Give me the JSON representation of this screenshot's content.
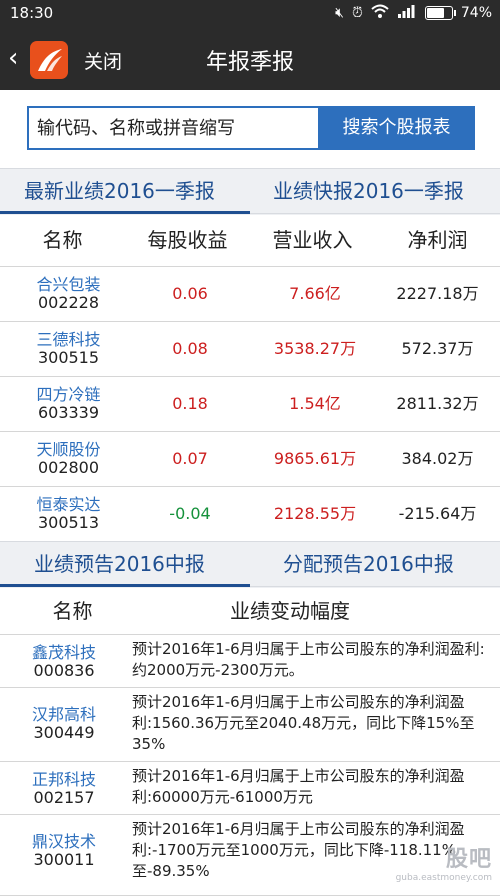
{
  "status": {
    "time": "18:30",
    "battery": "74%",
    "icons": [
      "mute-icon",
      "alarm-icon",
      "wifi-icon",
      "signal-icon",
      "battery-icon"
    ]
  },
  "nav": {
    "back_icon": "chevron-left-icon",
    "close_label": "关闭",
    "title": "年报季报"
  },
  "search": {
    "placeholder": "输代码、名称或拼音缩写",
    "value": "",
    "button_label": "搜索个股报表"
  },
  "tabs1": [
    {
      "label": "最新业绩2016一季报",
      "active": true
    },
    {
      "label": "业绩快报2016一季报",
      "active": false
    }
  ],
  "table1": {
    "headers": [
      "名称",
      "每股收益",
      "营业收入",
      "净利润"
    ],
    "rows": [
      {
        "name": "合兴包装",
        "code": "002228",
        "eps": "0.06",
        "revenue": "7.66亿",
        "profit": "2227.18万",
        "eps_color": "red"
      },
      {
        "name": "三德科技",
        "code": "300515",
        "eps": "0.08",
        "revenue": "3538.27万",
        "profit": "572.37万",
        "eps_color": "red"
      },
      {
        "name": "四方冷链",
        "code": "603339",
        "eps": "0.18",
        "revenue": "1.54亿",
        "profit": "2811.32万",
        "eps_color": "red"
      },
      {
        "name": "天顺股份",
        "code": "002800",
        "eps": "0.07",
        "revenue": "9865.61万",
        "profit": "384.02万",
        "eps_color": "red"
      },
      {
        "name": "恒泰实达",
        "code": "300513",
        "eps": "-0.04",
        "revenue": "2128.55万",
        "profit": "-215.64万",
        "eps_color": "green"
      }
    ]
  },
  "tabs2": [
    {
      "label": "业绩预告2016中报",
      "active": true
    },
    {
      "label": "分配预告2016中报",
      "active": false
    }
  ],
  "table2": {
    "headers": [
      "名称",
      "业绩变动幅度"
    ],
    "rows": [
      {
        "name": "鑫茂科技",
        "code": "000836",
        "desc": "预计2016年1-6月归属于上市公司股东的净利润盈利:约2000万元-2300万元。"
      },
      {
        "name": "汉邦高科",
        "code": "300449",
        "desc": "预计2016年1-6月归属于上市公司股东的净利润盈利:1560.36万元至2040.48万元，同比下降15%至35%"
      },
      {
        "name": "正邦科技",
        "code": "002157",
        "desc": "预计2016年1-6月归属于上市公司股东的净利润盈利:60000万元-61000万元"
      },
      {
        "name": "鼎汉技术",
        "code": "300011",
        "desc": "预计2016年1-6月归属于上市公司股东的净利润盈利:-1700万元至1000万元，同比下降-118.11%至-89.35%"
      }
    ]
  },
  "watermark": {
    "big": "股吧",
    "small": "guba.eastmoney.com"
  },
  "colors": {
    "accent": "#2d6fbd",
    "up": "#cc1f1f",
    "down": "#15913b",
    "header_bg": "#2b2b2b"
  }
}
